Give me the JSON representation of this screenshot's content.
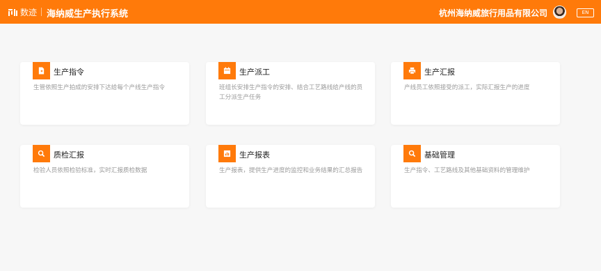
{
  "header": {
    "logo_text": "数迹",
    "system_title": "海纳威生产执行系统",
    "company": "杭州海纳威旅行用品有限公司",
    "lang_button": "EN",
    "bg_color": "#ff7a0a"
  },
  "cards": [
    {
      "title": "生产指令",
      "icon": "document-icon",
      "description": "生管依照生产拍成的安排下达给每个产线生产指令"
    },
    {
      "title": "生产派工",
      "icon": "calendar-icon",
      "description": "班组长安排生产指令的安排、结合工艺路线给产线的员工分派生产任务"
    },
    {
      "title": "生产汇报",
      "icon": "printer-icon",
      "description": "产线员工依照接受的派工，实际汇报生产的进度"
    },
    {
      "title": "质检汇报",
      "icon": "search-icon",
      "description": "检验人员依照检验标准，实时汇报质检数据"
    },
    {
      "title": "生产报表",
      "icon": "bar-chart-icon",
      "description": "生产报表，提供生产进度的监控和业务结果的汇总报告"
    },
    {
      "title": "基础管理",
      "icon": "search-icon",
      "description": "生产指令、工艺路线及其他基础资料的管理维护"
    }
  ]
}
